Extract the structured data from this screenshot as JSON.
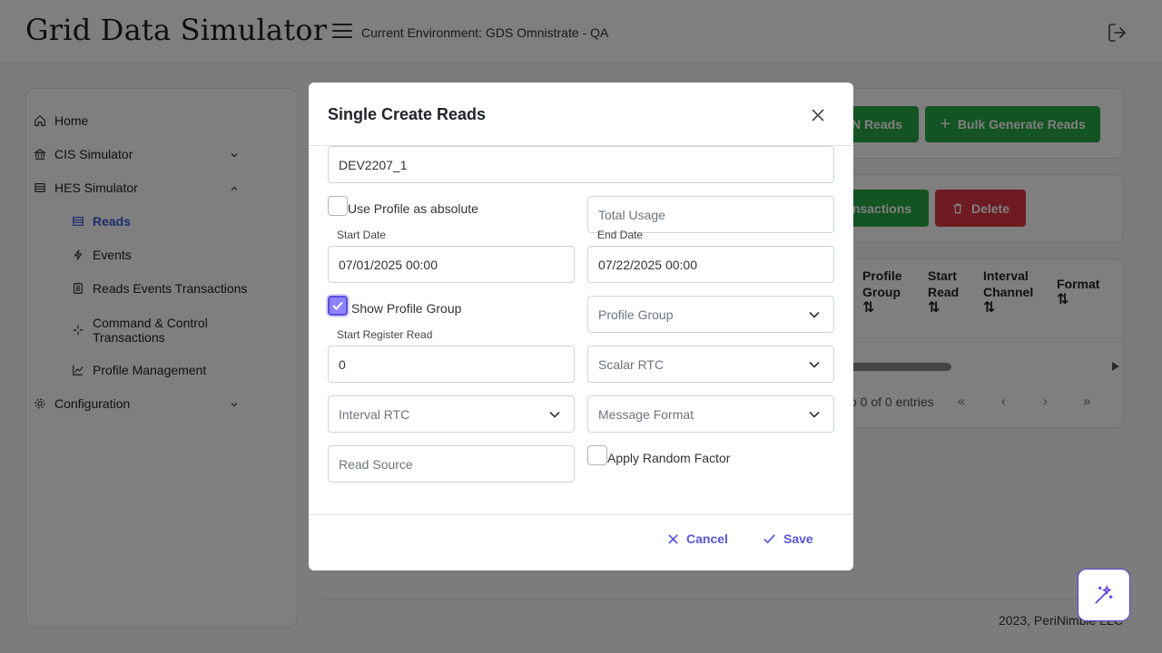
{
  "header": {
    "app_title": "Grid Data Simulator",
    "environment": "Current Environment: GDS Omnistrate - QA"
  },
  "sidebar": {
    "items": [
      {
        "label": "Home"
      },
      {
        "label": "CIS Simulator"
      },
      {
        "label": "HES Simulator"
      },
      {
        "label": "Reads"
      },
      {
        "label": "Events"
      },
      {
        "label": "Reads Events Transactions"
      },
      {
        "label": "Command & Control Transactions"
      },
      {
        "label": "Profile Management"
      },
      {
        "label": "Configuration"
      }
    ]
  },
  "page": {
    "actions": {
      "generate_n_reads_visible": "N Reads",
      "bulk_generate_reads": "Bulk Generate Reads",
      "transactions_visible": "nsactions",
      "delete": "Delete"
    },
    "table": {
      "headers": [
        "Profile Group",
        "Start Read",
        "Interval Channel",
        "Format"
      ]
    },
    "pagination_text": "o 0 of 0 entries",
    "pager_icons": [
      "first-page-icon",
      "prev-page-icon",
      "next-page-icon",
      "last-page-icon"
    ],
    "footer": "2023, PeriNimble LLC"
  },
  "modal": {
    "title": "Single Create Reads",
    "device_id": "DEV2207_1",
    "use_profile_absolute": {
      "label": "Use Profile as absolute",
      "checked": false
    },
    "total_usage": {
      "placeholder": "Total Usage"
    },
    "start_date": {
      "label": "Start Date",
      "value": "07/01/2025 00:00"
    },
    "end_date": {
      "label": "End Date",
      "value": "07/22/2025 00:00"
    },
    "show_profile_group": {
      "label": "Show Profile Group",
      "checked": true
    },
    "profile_group": {
      "placeholder": "Profile Group"
    },
    "start_register_read": {
      "label": "Start Register Read",
      "value": "0"
    },
    "scalar_rtc": {
      "placeholder": "Scalar RTC"
    },
    "interval_rtc": {
      "placeholder": "Interval RTC"
    },
    "message_format": {
      "placeholder": "Message Format"
    },
    "read_source": {
      "placeholder": "Read Source"
    },
    "apply_random_factor": {
      "label": "Apply Random Factor",
      "checked": false
    },
    "cancel_label": "Cancel",
    "save_label": "Save"
  },
  "colors": {
    "accent": "#5a55d8",
    "green": "#28a745",
    "red": "#dc3545",
    "active_nav": "#3b5bdb"
  }
}
